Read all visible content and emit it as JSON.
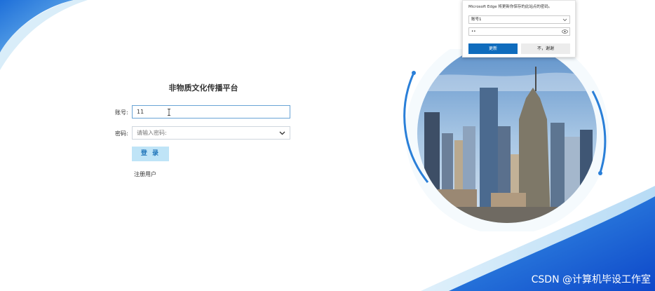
{
  "form": {
    "title": "非物质文化传播平台",
    "account_label": "账号:",
    "account_value": "11",
    "password_label": "密码:",
    "password_placeholder": "请输入密码:",
    "login_label": "登 录",
    "register_label": "注册用户"
  },
  "edge_popup": {
    "message": "Microsoft Edge 将更新你保存的此站点的密码。",
    "account_value": "账号1",
    "password_value": "••",
    "update_label": "更新",
    "no_thanks_label": "不，谢谢"
  },
  "watermark": "CSDN @计算机毕设工作室",
  "colors": {
    "accent_blue": "#1565c0",
    "light_blue": "#bfe4f7",
    "edge_blue": "#0f6cbd"
  }
}
